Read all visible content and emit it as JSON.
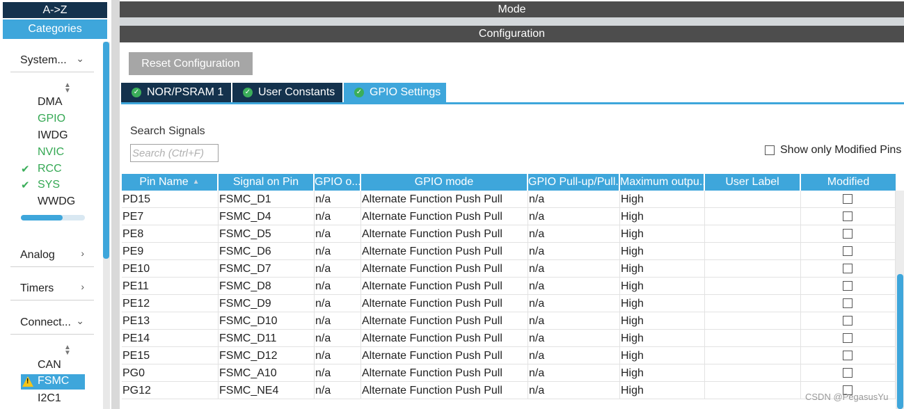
{
  "left_panel": {
    "az_label": "A->Z",
    "categories_label": "Categories",
    "groups": {
      "system": {
        "label": "System...",
        "items": [
          {
            "label": "DMA",
            "state": "none"
          },
          {
            "label": "GPIO",
            "state": "green"
          },
          {
            "label": "IWDG",
            "state": "none"
          },
          {
            "label": "NVIC",
            "state": "green"
          },
          {
            "label": "RCC",
            "state": "check"
          },
          {
            "label": "SYS",
            "state": "check"
          },
          {
            "label": "WWDG",
            "state": "none"
          }
        ]
      },
      "analog": {
        "label": "Analog"
      },
      "timers": {
        "label": "Timers"
      },
      "connectivity": {
        "label": "Connect...",
        "items": [
          {
            "label": "CAN",
            "state": "none"
          },
          {
            "label": "FSMC",
            "state": "warning-selected"
          },
          {
            "label": "I2C1",
            "state": "none"
          }
        ]
      }
    },
    "icons": {
      "chevron_down": "chevron-down-icon",
      "chevron_right": "chevron-right-icon",
      "check": "check-icon",
      "warning": "warning-icon",
      "sort": "sort-icon"
    }
  },
  "mode_title": "Mode",
  "config_title": "Configuration",
  "reset_label": "Reset Configuration",
  "tabs": [
    {
      "label": "NOR/PSRAM 1",
      "active": false
    },
    {
      "label": "User Constants",
      "active": false
    },
    {
      "label": "GPIO Settings",
      "active": true
    }
  ],
  "search": {
    "label": "Search Signals",
    "placeholder": "Search (Ctrl+F)"
  },
  "show_modified_label": "Show only Modified Pins",
  "table": {
    "columns": [
      "Pin Name",
      "Signal on Pin",
      "GPIO o...",
      "GPIO mode",
      "GPIO Pull-up/Pull...",
      "Maximum outpu...",
      "User Label",
      "Modified"
    ],
    "rows": [
      [
        "PD15",
        "FSMC_D1",
        "n/a",
        "Alternate Function Push Pull",
        "n/a",
        "High",
        ""
      ],
      [
        "PE7",
        "FSMC_D4",
        "n/a",
        "Alternate Function Push Pull",
        "n/a",
        "High",
        ""
      ],
      [
        "PE8",
        "FSMC_D5",
        "n/a",
        "Alternate Function Push Pull",
        "n/a",
        "High",
        ""
      ],
      [
        "PE9",
        "FSMC_D6",
        "n/a",
        "Alternate Function Push Pull",
        "n/a",
        "High",
        ""
      ],
      [
        "PE10",
        "FSMC_D7",
        "n/a",
        "Alternate Function Push Pull",
        "n/a",
        "High",
        ""
      ],
      [
        "PE11",
        "FSMC_D8",
        "n/a",
        "Alternate Function Push Pull",
        "n/a",
        "High",
        ""
      ],
      [
        "PE12",
        "FSMC_D9",
        "n/a",
        "Alternate Function Push Pull",
        "n/a",
        "High",
        ""
      ],
      [
        "PE13",
        "FSMC_D10",
        "n/a",
        "Alternate Function Push Pull",
        "n/a",
        "High",
        ""
      ],
      [
        "PE14",
        "FSMC_D11",
        "n/a",
        "Alternate Function Push Pull",
        "n/a",
        "High",
        ""
      ],
      [
        "PE15",
        "FSMC_D12",
        "n/a",
        "Alternate Function Push Pull",
        "n/a",
        "High",
        ""
      ],
      [
        "PG0",
        "FSMC_A10",
        "n/a",
        "Alternate Function Push Pull",
        "n/a",
        "High",
        ""
      ],
      [
        "PG12",
        "FSMC_NE4",
        "n/a",
        "Alternate Function Push Pull",
        "n/a",
        "High",
        ""
      ]
    ]
  },
  "watermark": "CSDN @PegasusYu",
  "colors": {
    "accent": "#3ea6db",
    "navy": "#14324d",
    "header_gray": "#4d4d4d",
    "ok_green": "#3bae5a",
    "warning": "#f5c518"
  }
}
